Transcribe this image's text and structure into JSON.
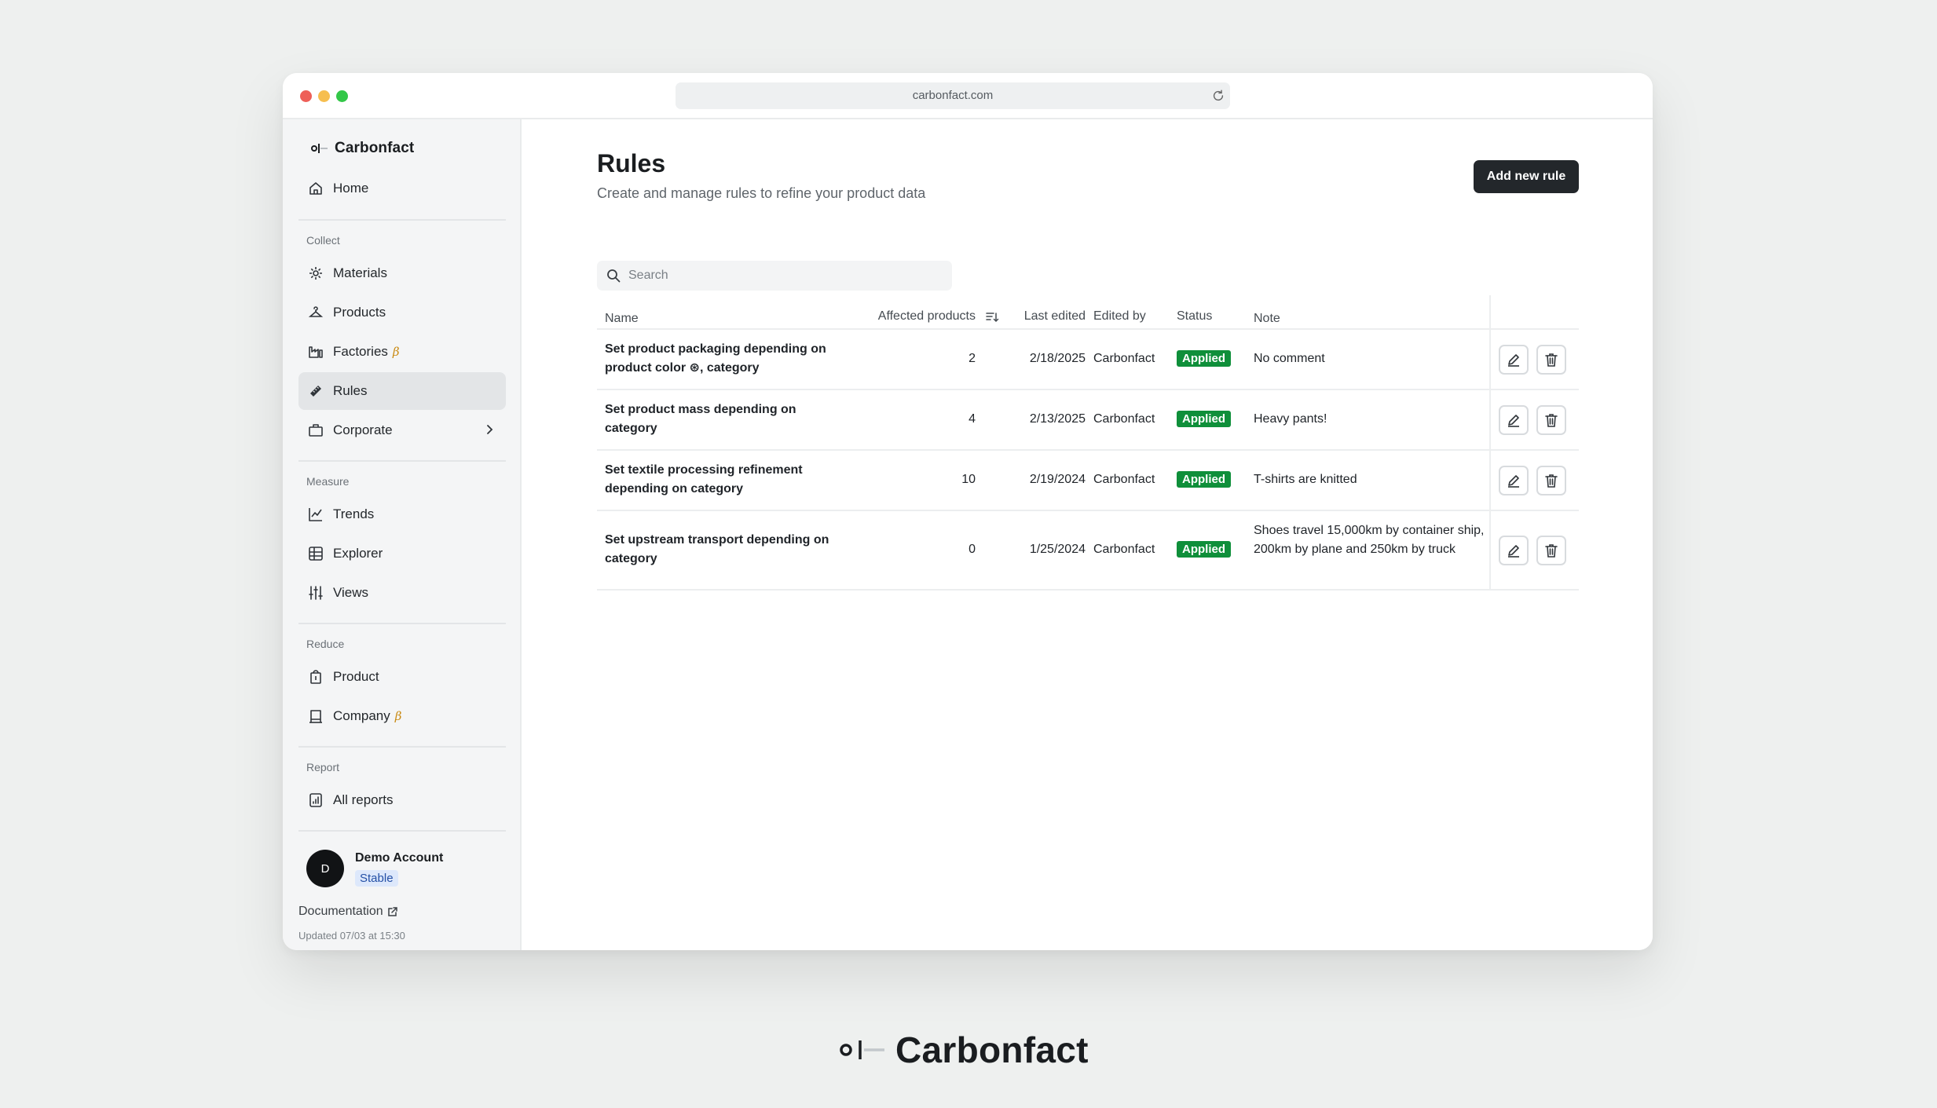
{
  "browser": {
    "url": "carbonfact.com"
  },
  "brand": {
    "name": "Carbonfact"
  },
  "sidebar": {
    "home": "Home",
    "sections": {
      "collect": "Collect",
      "measure": "Measure",
      "reduce": "Reduce",
      "report": "Report"
    },
    "items": {
      "materials": "Materials",
      "products": "Products",
      "factories": "Factories",
      "rules": "Rules",
      "corporate": "Corporate",
      "trends": "Trends",
      "explorer": "Explorer",
      "views": "Views",
      "product": "Product",
      "company": "Company",
      "all_reports": "All reports"
    },
    "beta_symbol": "β",
    "account": {
      "initial": "D",
      "name": "Demo Account",
      "badge": "Stable"
    },
    "documentation": "Documentation",
    "updated": "Updated 07/03 at 15:30"
  },
  "main": {
    "title": "Rules",
    "subtitle": "Create and manage rules to refine your product data",
    "add_button": "Add new rule",
    "search_placeholder": "Search"
  },
  "table": {
    "columns": {
      "name": "Name",
      "affected": "Affected products",
      "last_edited": "Last edited",
      "edited_by": "Edited by",
      "status": "Status",
      "note": "Note"
    },
    "rows": [
      {
        "name": "Set product packaging depending on product color ⊛, category",
        "affected": "2",
        "last_edited": "2/18/2025",
        "edited_by": "Carbonfact",
        "status": "Applied",
        "note": "No comment"
      },
      {
        "name": "Set product mass depending on category",
        "affected": "4",
        "last_edited": "2/13/2025",
        "edited_by": "Carbonfact",
        "status": "Applied",
        "note": "Heavy pants!"
      },
      {
        "name": "Set textile processing refinement depending on category",
        "affected": "10",
        "last_edited": "2/19/2024",
        "edited_by": "Carbonfact",
        "status": "Applied",
        "note": "T-shirts are knitted"
      },
      {
        "name": "Set upstream transport depending on category",
        "affected": "0",
        "last_edited": "1/25/2024",
        "edited_by": "Carbonfact",
        "status": "Applied",
        "note": "Shoes travel 15,000km by container ship, 200km by plane and 250km by truck"
      }
    ]
  },
  "footer": {
    "brand": "Carbonfact"
  },
  "colors": {
    "accent": "#23272b",
    "status_applied": "#0f8f3a",
    "badge_stable_bg": "#dde8fb"
  }
}
